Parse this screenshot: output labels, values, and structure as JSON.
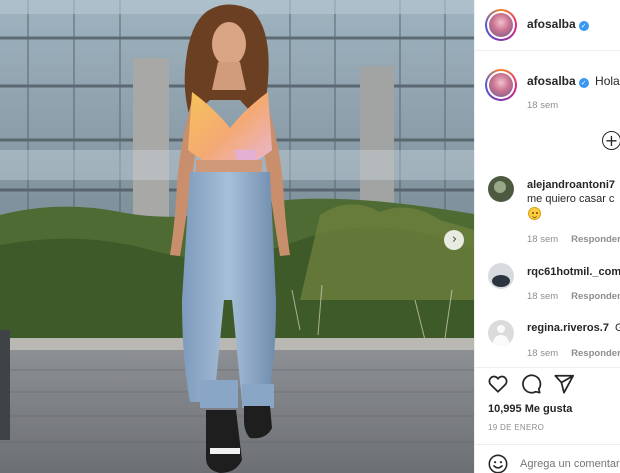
{
  "post": {
    "author": "afosalba",
    "caption": "Hola",
    "caption_time": "18 sem"
  },
  "comments": [
    {
      "username": "alejandroantoni7",
      "text": "me quiero casar c",
      "time": "18 sem",
      "reply_label": "Responder",
      "avatar_color": "#4d5a3f"
    },
    {
      "username": "rqc61hotmil._com",
      "text": "",
      "time": "18 sem",
      "reply_label": "Responder",
      "avatar_color": "#2c3440"
    },
    {
      "username": "regina.riveros.7",
      "text": "G",
      "time": "18 sem",
      "reply_label": "Responder",
      "avatar_color": "#dbdbdb"
    }
  ],
  "actions": {
    "like_icon": "heart-icon",
    "comment_icon": "comment-icon",
    "share_icon": "send-icon"
  },
  "likes_text": "10,995 Me gusta",
  "date_text": "19 DE ENERO",
  "comment_box": {
    "placeholder": "Agrega un comentario...",
    "emoji_icon": "smiley-icon"
  },
  "colors": {
    "verified": "#3897f0",
    "muted": "#8e8e8e",
    "text": "#262626"
  }
}
